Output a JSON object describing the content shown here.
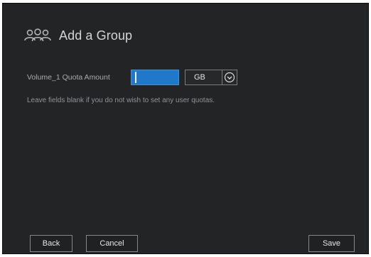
{
  "dialog": {
    "title": "Add a Group",
    "header_icon": "group-icon"
  },
  "quota": {
    "label": "Volume_1 Quota Amount",
    "value": "",
    "unit": "GB",
    "unit_dropdown_icon": "chevron-down-icon"
  },
  "hint": "Leave fields blank if you do not wish to set any user quotas.",
  "buttons": {
    "back": "Back",
    "cancel": "Cancel",
    "save": "Save"
  },
  "colors": {
    "background": "#232426",
    "input_active": "#1f78c8",
    "text": "#d2d5d8"
  }
}
